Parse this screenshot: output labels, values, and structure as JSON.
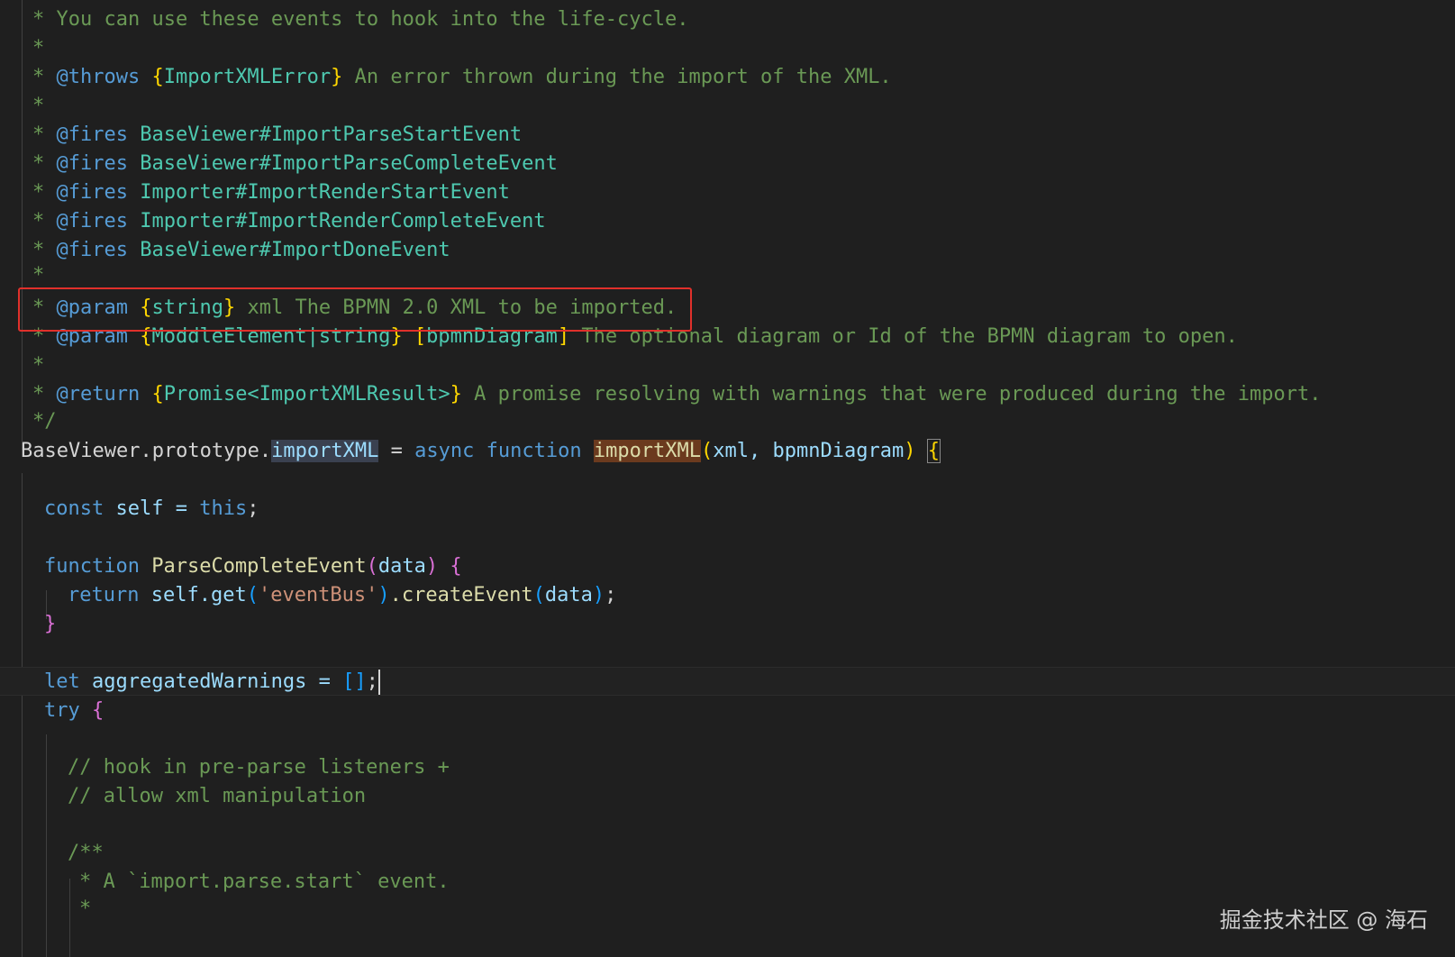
{
  "code": {
    "l1": "* You can use these events to hook into the life-cycle.",
    "star": "*",
    "throws_tag": "@throws",
    "throws_type": "ImportXMLError",
    "throws_desc": " An error thrown during the import of the XML.",
    "fires_tag": "@fires",
    "fires": [
      "BaseViewer#ImportParseStartEvent",
      "BaseViewer#ImportParseCompleteEvent",
      "Importer#ImportRenderStartEvent",
      "Importer#ImportRenderCompleteEvent",
      "BaseViewer#ImportDoneEvent"
    ],
    "param_tag": "@param",
    "param1_type": "string",
    "param1_desc": " xml The BPMN 2.0 XML to be imported.",
    "param2_type": "ModdleElement|string",
    "param2_name": "bpmnDiagram",
    "param2_desc": " The optional diagram or Id of the BPMN diagram to open.",
    "return_tag": "@return",
    "return_type": "Promise<ImportXMLResult>",
    "return_desc": " A promise resolving with warnings that were produced during the import.",
    "comment_end": "*/",
    "proto_prefix": "BaseViewer.prototype.",
    "proto_name": "importXML",
    "eq": " = ",
    "kw_async": "async",
    "kw_function": "function",
    "fn_name": "importXML",
    "fn_args": "xml, bpmnDiagram",
    "kw_const": "const",
    "self_assign": " self = ",
    "kw_this": "this",
    "fn2_name": "ParseCompleteEvent",
    "fn2_arg": "data",
    "kw_return": "return",
    "self_get": " self.get",
    "eventbus_str": "'eventBus'",
    "create_event": ".createEvent",
    "kw_let": "let",
    "agg_decl": " aggregatedWarnings = ",
    "kw_try": "try",
    "comment_hook1": "// hook in pre-parse listeners +",
    "comment_hook2": "// allow xml manipulation",
    "doc_open": "/**",
    "doc_event": "* A `import.parse.start` event."
  },
  "watermark": "掘金技术社区 @ 海石"
}
